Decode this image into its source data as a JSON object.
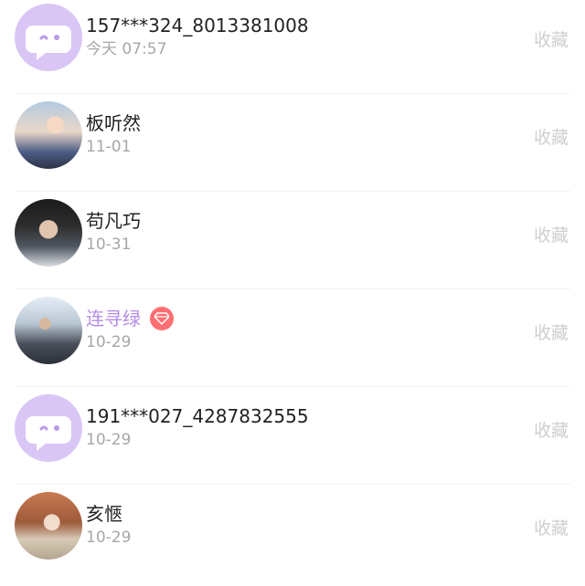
{
  "items": [
    {
      "name": "157***324_8013381008",
      "date": "今天 07:57",
      "action": "收藏",
      "avatar_icon": "default-chat-avatar-icon",
      "vip": false
    },
    {
      "name": "板听然",
      "date": "11-01",
      "action": "收藏",
      "avatar_icon": "user-photo-avatar",
      "vip": false
    },
    {
      "name": "苟凡巧",
      "date": "10-31",
      "action": "收藏",
      "avatar_icon": "user-photo-avatar",
      "vip": false
    },
    {
      "name": "连寻绿",
      "date": "10-29",
      "action": "收藏",
      "avatar_icon": "user-photo-avatar",
      "vip": true
    },
    {
      "name": "191***027_4287832555",
      "date": "10-29",
      "action": "收藏",
      "avatar_icon": "default-chat-avatar-icon",
      "vip": false
    },
    {
      "name": "亥愜",
      "date": "10-29",
      "action": "收藏",
      "avatar_icon": "user-photo-avatar",
      "vip": false
    }
  ],
  "colors": {
    "vip_name": "#b58be6",
    "vip_badge": "#ff6f73",
    "default_avatar_bg": "#d9c6f5"
  }
}
